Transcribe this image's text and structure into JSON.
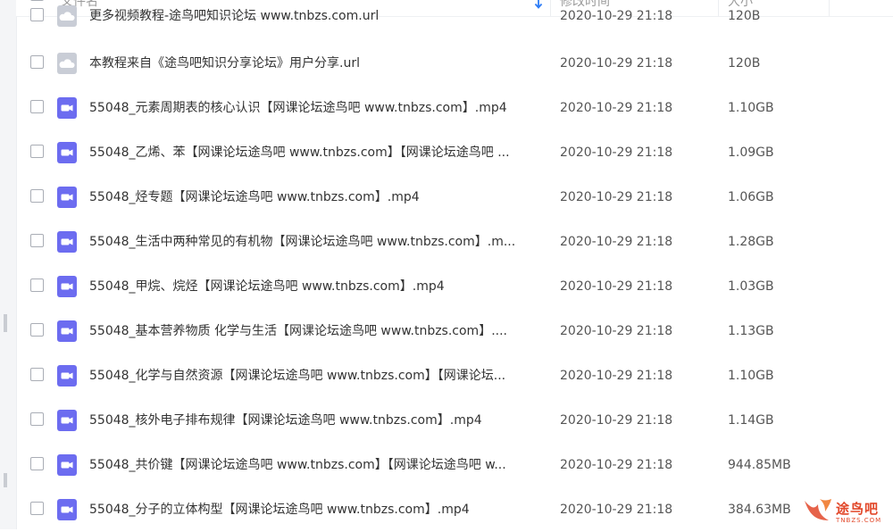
{
  "header": {
    "name_label": "文件名",
    "modified_label": "修改时间",
    "size_label": "大小"
  },
  "files": [
    {
      "name": "更多视频教程-途鸟吧知识论坛 www.tnbzs.com.url",
      "date": "2020-10-29 21:18",
      "size": "120B",
      "type": "url"
    },
    {
      "name": "本教程来自《途鸟吧知识分享论坛》用户分享.url",
      "date": "2020-10-29 21:18",
      "size": "120B",
      "type": "url"
    },
    {
      "name": "55048_元素周期表的核心认识【网课论坛途鸟吧 www.tnbzs.com】.mp4",
      "date": "2020-10-29 21:18",
      "size": "1.10GB",
      "type": "video"
    },
    {
      "name": "55048_乙烯、苯【网课论坛途鸟吧 www.tnbzs.com】【网课论坛途鸟吧 ...",
      "date": "2020-10-29 21:18",
      "size": "1.09GB",
      "type": "video"
    },
    {
      "name": "55048_烃专题【网课论坛途鸟吧 www.tnbzs.com】.mp4",
      "date": "2020-10-29 21:18",
      "size": "1.06GB",
      "type": "video"
    },
    {
      "name": "55048_生活中两种常见的有机物【网课论坛途鸟吧 www.tnbzs.com】.m...",
      "date": "2020-10-29 21:18",
      "size": "1.28GB",
      "type": "video"
    },
    {
      "name": "55048_甲烷、烷烃【网课论坛途鸟吧 www.tnbzs.com】.mp4",
      "date": "2020-10-29 21:18",
      "size": "1.03GB",
      "type": "video"
    },
    {
      "name": "55048_基本营养物质  化学与生活【网课论坛途鸟吧 www.tnbzs.com】....",
      "date": "2020-10-29 21:18",
      "size": "1.13GB",
      "type": "video"
    },
    {
      "name": "55048_化学与自然资源【网课论坛途鸟吧 www.tnbzs.com】【网课论坛...",
      "date": "2020-10-29 21:18",
      "size": "1.10GB",
      "type": "video"
    },
    {
      "name": "55048_核外电子排布规律【网课论坛途鸟吧 www.tnbzs.com】.mp4",
      "date": "2020-10-29 21:18",
      "size": "1.14GB",
      "type": "video"
    },
    {
      "name": "55048_共价键【网课论坛途鸟吧 www.tnbzs.com】【网课论坛途鸟吧 w...",
      "date": "2020-10-29 21:18",
      "size": "944.85MB",
      "type": "video"
    },
    {
      "name": "55048_分子的立体构型【网课论坛途鸟吧 www.tnbzs.com】.mp4",
      "date": "2020-10-29 21:18",
      "size": "384.63MB",
      "type": "video"
    }
  ],
  "watermark": {
    "text": "途鸟吧",
    "sub": "TNBZS.COM"
  },
  "colors": {
    "video_icon": "#6c6cf0",
    "url_icon": "#c9cdd6",
    "accent": "#2e7df6"
  }
}
